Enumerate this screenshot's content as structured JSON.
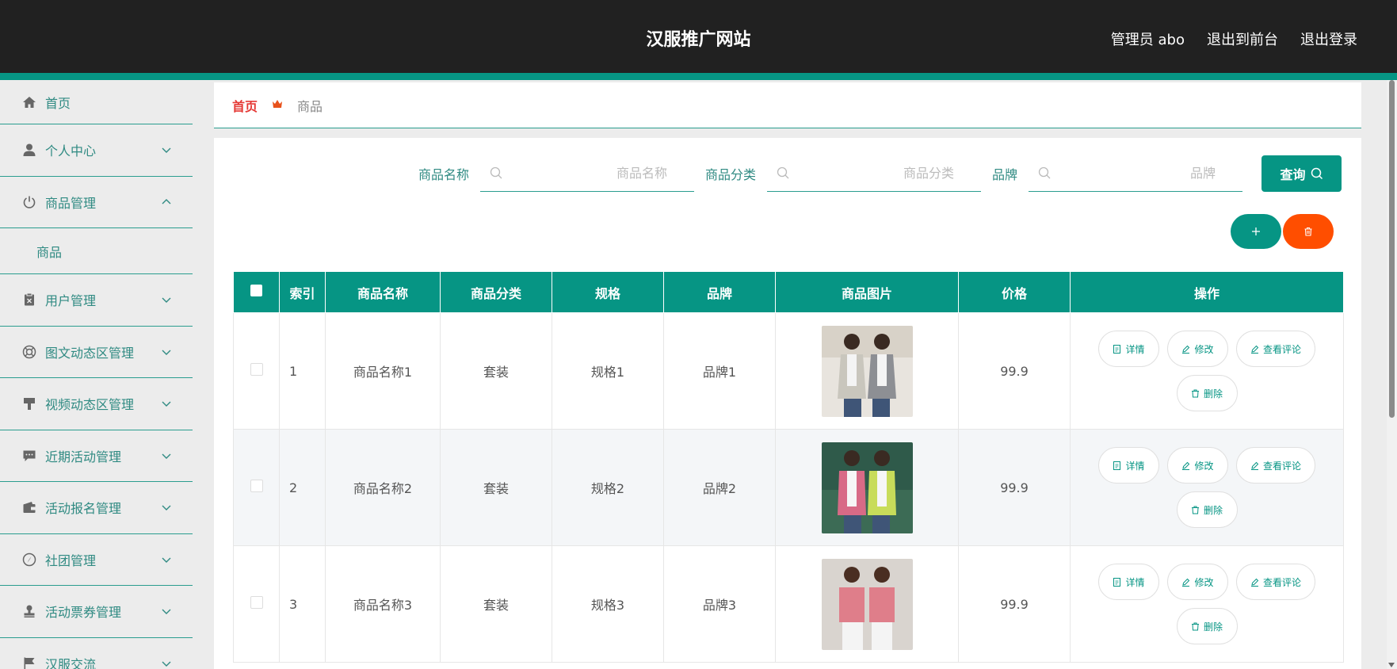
{
  "header": {
    "title": "汉服推广网站",
    "admin": "管理员 abo",
    "to_front": "退出到前台",
    "logout": "退出登录"
  },
  "sidebar": {
    "items": [
      {
        "label": "首页",
        "icon": "home-icon"
      },
      {
        "label": "个人中心",
        "icon": "user-icon"
      },
      {
        "label": "商品管理",
        "icon": "power-icon"
      },
      {
        "label": "商品",
        "sub": true
      },
      {
        "label": "用户管理",
        "icon": "clipboard-icon"
      },
      {
        "label": "图文动态区管理",
        "icon": "lifebuoy-icon"
      },
      {
        "label": "视频动态区管理",
        "icon": "brush-icon"
      },
      {
        "label": "近期活动管理",
        "icon": "chat-icon"
      },
      {
        "label": "活动报名管理",
        "icon": "wallet-icon"
      },
      {
        "label": "社团管理",
        "icon": "compass-icon"
      },
      {
        "label": "活动票券管理",
        "icon": "stamp-icon"
      },
      {
        "label": "汉服交流",
        "icon": "flag-icon"
      }
    ]
  },
  "breadcrumb": {
    "home": "首页",
    "current": "商品"
  },
  "search": {
    "name_label": "商品名称",
    "name_placeholder": "商品名称",
    "category_label": "商品分类",
    "category_placeholder": "商品分类",
    "brand_label": "品牌",
    "brand_placeholder": "品牌",
    "query_button": "查询"
  },
  "table": {
    "headers": [
      "索引",
      "商品名称",
      "商品分类",
      "规格",
      "品牌",
      "商品图片",
      "价格",
      "操作"
    ],
    "rows": [
      {
        "index": "1",
        "name": "商品名称1",
        "category": "套装",
        "spec": "规格1",
        "brand": "品牌1",
        "price": "99.9"
      },
      {
        "index": "2",
        "name": "商品名称2",
        "category": "套装",
        "spec": "规格2",
        "brand": "品牌2",
        "price": "99.9"
      },
      {
        "index": "3",
        "name": "商品名称3",
        "category": "套装",
        "spec": "规格3",
        "brand": "品牌3",
        "price": "99.9"
      }
    ],
    "actions": {
      "detail": "详情",
      "edit": "修改",
      "comments": "查看评论",
      "delete": "删除"
    }
  },
  "colors": {
    "primary": "#069584",
    "danger": "#ff4e00",
    "header_bg": "#212121"
  }
}
